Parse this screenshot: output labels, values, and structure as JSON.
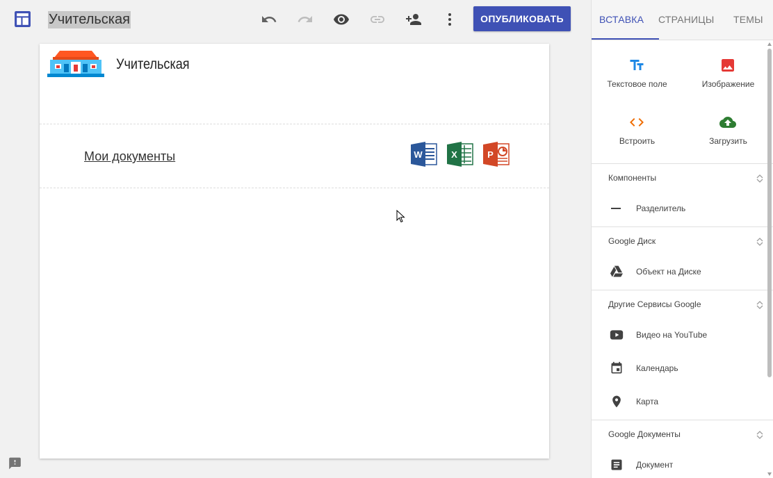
{
  "topbar": {
    "site_title": "Учительская",
    "publish_label": "ОПУБЛИКОВАТЬ",
    "icons": [
      "sites-logo-icon",
      "undo-icon",
      "redo-icon",
      "preview-eye-icon",
      "link-icon",
      "share-person-add-icon",
      "more-vert-icon"
    ]
  },
  "page": {
    "site_name": "Учительская",
    "docs_link": "Мои документы",
    "office_icons": [
      "word-icon",
      "excel-icon",
      "powerpoint-icon"
    ]
  },
  "panel": {
    "tabs": [
      "ВСТАВКА",
      "СТРАНИЦЫ",
      "ТЕМЫ"
    ],
    "active_tab": 0,
    "insert_items": [
      {
        "label": "Текстовое поле",
        "icon": "text-box-icon",
        "color": "#1e88e5"
      },
      {
        "label": "Изображение",
        "icon": "image-icon",
        "color": "#e53935"
      },
      {
        "label": "Встроить",
        "icon": "embed-code-icon",
        "color": "#ef6c00"
      },
      {
        "label": "Загрузить",
        "icon": "upload-cloud-icon",
        "color": "#2e7d32"
      }
    ],
    "sections": [
      {
        "title": "Компоненты",
        "items": [
          {
            "label": "Разделитель",
            "icon": "divider-icon"
          }
        ]
      },
      {
        "title": "Google Диск",
        "items": [
          {
            "label": "Объект на Диске",
            "icon": "drive-icon"
          }
        ]
      },
      {
        "title": "Другие Сервисы Google",
        "items": [
          {
            "label": "Видео на YouTube",
            "icon": "youtube-icon"
          },
          {
            "label": "Календарь",
            "icon": "calendar-icon"
          },
          {
            "label": "Карта",
            "icon": "map-pin-icon"
          }
        ]
      },
      {
        "title": "Google Документы",
        "items": [
          {
            "label": "Документ",
            "icon": "document-icon"
          }
        ]
      }
    ]
  },
  "colors": {
    "accent": "#3f51b5",
    "word": "#2b579a",
    "excel": "#217346",
    "powerpoint": "#d24726"
  }
}
